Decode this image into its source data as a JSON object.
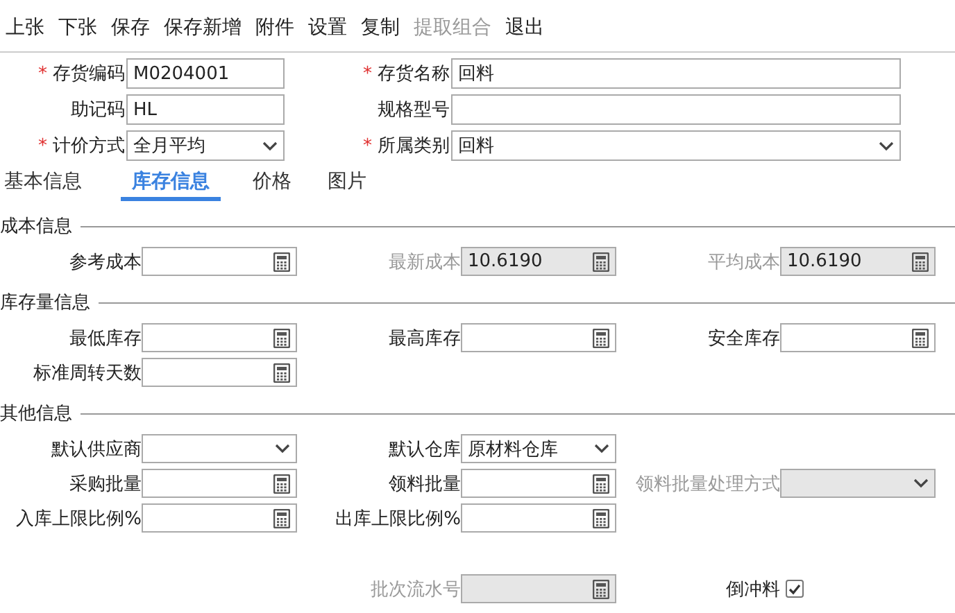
{
  "toolbar": [
    {
      "label": "上张",
      "disabled": false
    },
    {
      "label": "下张",
      "disabled": false
    },
    {
      "label": "保存",
      "disabled": false
    },
    {
      "label": "保存新增",
      "disabled": false
    },
    {
      "label": "附件",
      "disabled": false
    },
    {
      "label": "设置",
      "disabled": false
    },
    {
      "label": "复制",
      "disabled": false
    },
    {
      "label": "提取组合",
      "disabled": true
    },
    {
      "label": "退出",
      "disabled": false
    }
  ],
  "header": {
    "rows": [
      [
        {
          "label": "存货编码",
          "required_mark": "*",
          "kind": "text",
          "value": "M0204001"
        },
        {
          "label": "存货名称",
          "required_mark": "*",
          "kind": "text",
          "value": "回料"
        }
      ],
      [
        {
          "label": "助记码",
          "kind": "text",
          "value": "HL"
        },
        {
          "label": "规格型号",
          "kind": "text"
        }
      ],
      [
        {
          "label": "计价方式",
          "required_mark": "*",
          "kind": "select",
          "value": "全月平均"
        },
        {
          "label": "所属类别",
          "required_mark": "*",
          "kind": "select",
          "value": "回料"
        }
      ]
    ]
  },
  "tabs": [
    {
      "label": "基本信息",
      "selected": false
    },
    {
      "label": "库存信息",
      "selected": true
    },
    {
      "label": "价格",
      "selected": false
    },
    {
      "label": "图片",
      "selected": false
    }
  ],
  "sections": [
    {
      "title": "成本信息",
      "rows": [
        [
          {
            "label": "参考成本",
            "kind": "number",
            "disabled": false
          },
          {
            "label": "最新成本",
            "kind": "number",
            "disabled": true,
            "value": "10.6190"
          },
          {
            "label": "平均成本",
            "kind": "number",
            "disabled": true,
            "value": "10.6190"
          }
        ]
      ]
    },
    {
      "title": "库存量信息",
      "rows": [
        [
          {
            "label": "最低库存",
            "kind": "number",
            "disabled": false
          },
          {
            "label": "最高库存",
            "kind": "number",
            "disabled": false
          },
          {
            "label": "安全库存",
            "kind": "number",
            "disabled": false
          }
        ],
        [
          {
            "label": "标准周转天数",
            "kind": "number",
            "disabled": false
          }
        ]
      ]
    },
    {
      "title": "其他信息",
      "rows": [
        [
          {
            "label": "默认供应商",
            "kind": "select",
            "disabled": false
          },
          {
            "label": "默认仓库",
            "kind": "select",
            "disabled": false,
            "value": "原材料仓库"
          }
        ],
        [
          {
            "label": "采购批量",
            "kind": "number",
            "disabled": false
          },
          {
            "label": "领料批量",
            "kind": "number",
            "disabled": false
          },
          {
            "label": "领料批量处理方式",
            "kind": "select",
            "disabled": true
          }
        ],
        [
          {
            "label": "入库上限比例%",
            "kind": "number",
            "disabled": false
          },
          {
            "label": "出库上限比例%",
            "kind": "number",
            "disabled": false
          }
        ],
        [
          null,
          {
            "label": "批次流水号",
            "kind": "number",
            "disabled": true
          },
          {
            "label": "倒冲料",
            "kind": "checkbox",
            "disabled": false,
            "checked": true
          }
        ]
      ]
    }
  ]
}
